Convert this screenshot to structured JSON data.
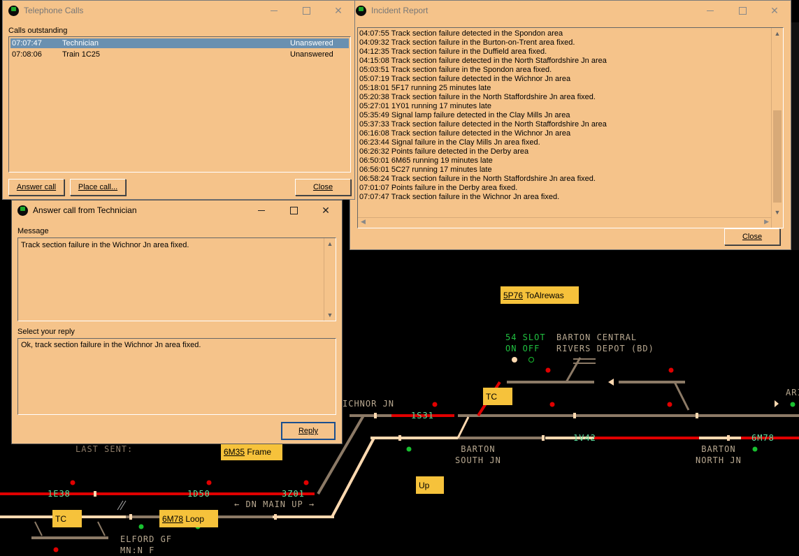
{
  "telephone_calls": {
    "title": "Telephone Calls",
    "section_label": "Calls outstanding",
    "calls": [
      {
        "time": "07:07:47",
        "caller": "Technician",
        "status": "Unanswered"
      },
      {
        "time": "07:08:06",
        "caller": "Train 1C25",
        "status": "Unanswered"
      }
    ],
    "answer_label": "Answer call",
    "place_label": "Place call...",
    "close_label": "Close"
  },
  "incident_report": {
    "title": "Incident Report",
    "entries": [
      "04:07:55 Track section failure detected in the Spondon area",
      "04:09:32 Track section failure in the Burton-on-Trent area fixed.",
      "04:12:35 Track section failure in the Duffield area fixed.",
      "04:15:08 Track section failure detected in the North Staffordshire Jn area",
      "05:03:51 Track section failure in the Spondon area fixed.",
      "05:07:19 Track section failure detected in the Wichnor Jn area",
      "05:18:01 5F17 running 25 minutes late",
      "05:20:38 Track section failure in the North Staffordshire Jn area fixed.",
      "05:27:01 1Y01 running 17 minutes late",
      "05:35:49 Signal lamp failure detected in the Clay Mills Jn area",
      "05:37:33 Track section failure detected in the North Staffordshire Jn area",
      "06:16:08 Track section failure detected in the Wichnor Jn area",
      "06:23:44 Signal failure in the Clay Mills Jn area fixed.",
      "06:26:32 Points failure detected in the Derby area",
      "06:50:01 6M65 running 19 minutes late",
      "06:56:01 5C27 running 17 minutes late",
      "06:58:24 Track section failure in the North Staffordshire Jn area fixed.",
      "07:01:07 Points failure in the Derby area fixed.",
      "07:07:47 Track section failure in the Wichnor Jn area fixed."
    ],
    "close_label": "Close"
  },
  "answer_call": {
    "title": "Answer call from Technician",
    "message_label": "Message",
    "message": "Track section failure in the Wichnor Jn area fixed.",
    "reply_label": "Select your reply",
    "reply": "Ok, track section failure in the Wichnor Jn area fixed.",
    "reply_button": "Reply"
  },
  "schematic": {
    "train_tags": [
      {
        "headcode": "5P76",
        "text": "ToAlrewas"
      },
      {
        "headcode": "6M35",
        "text": "Frame"
      },
      {
        "headcode": "6M78",
        "text": "Loop"
      }
    ],
    "tc_label": "TC",
    "up_label": "Up",
    "slot_line1": "54 SLOT",
    "slot_line2": "ON OFF",
    "place_barton_central": "BARTON CENTRAL",
    "place_rivers_depot": "RIVERS DEPOT (BD)",
    "place_wichnor": "ICHNOR JN",
    "place_barton_south_1": "BARTON",
    "place_barton_south_2": "SOUTH JN",
    "place_barton_north_1": "BARTON",
    "place_barton_north_2": "NORTH JN",
    "place_elford": "ELFORD GF",
    "elford_status": "MN:N  F",
    "last_sent": "LAST SENT:",
    "dn_main_up": "← DN MAIN UP →",
    "berths": [
      "1S31",
      "1V42",
      "6M78",
      "1E38",
      "1D50",
      "3Z01"
    ],
    "edge_label": "ARI",
    "colors": {
      "track_occupied": "#e00000",
      "track_clear": "#8c7a66",
      "track_route": "#ffd9b0",
      "berth_text": "#5fe0a0",
      "label_text": "#b8a890"
    }
  }
}
